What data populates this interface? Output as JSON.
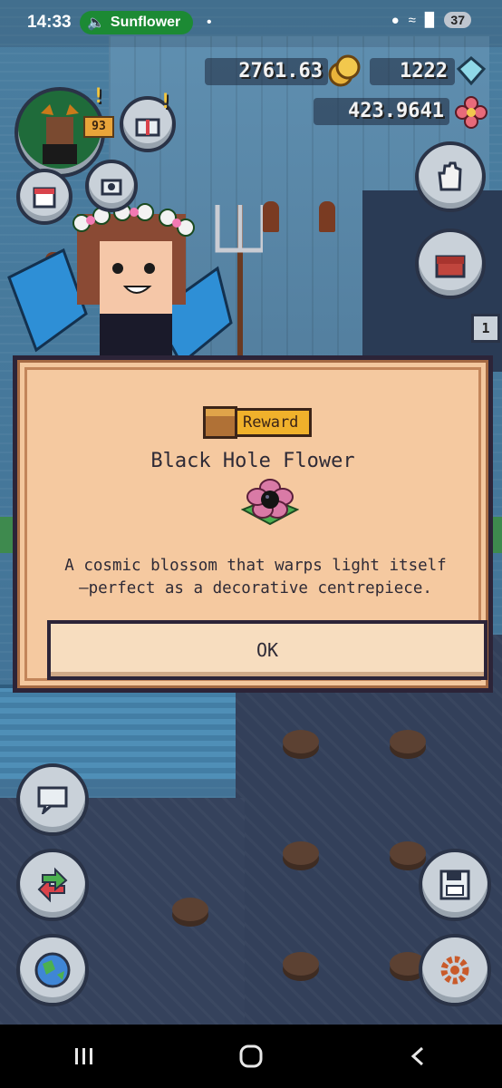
{
  "status_bar": {
    "time": "14:33",
    "app_name": "Sunflower",
    "battery": "37"
  },
  "hud": {
    "coins": "2761.63",
    "gems": "1222",
    "flower_balance": "423.9641",
    "level": "93",
    "notification_count": "1"
  },
  "modal": {
    "badge_label": "Reward",
    "title": "Black Hole Flower",
    "description": "A cosmic blossom that warps light itself\n—perfect as a decorative centrepiece.",
    "ok_label": "OK"
  },
  "colors": {
    "modal_bg": "#f3c79d",
    "badge": "#f0b12b",
    "status_pill": "#1c8a34"
  }
}
